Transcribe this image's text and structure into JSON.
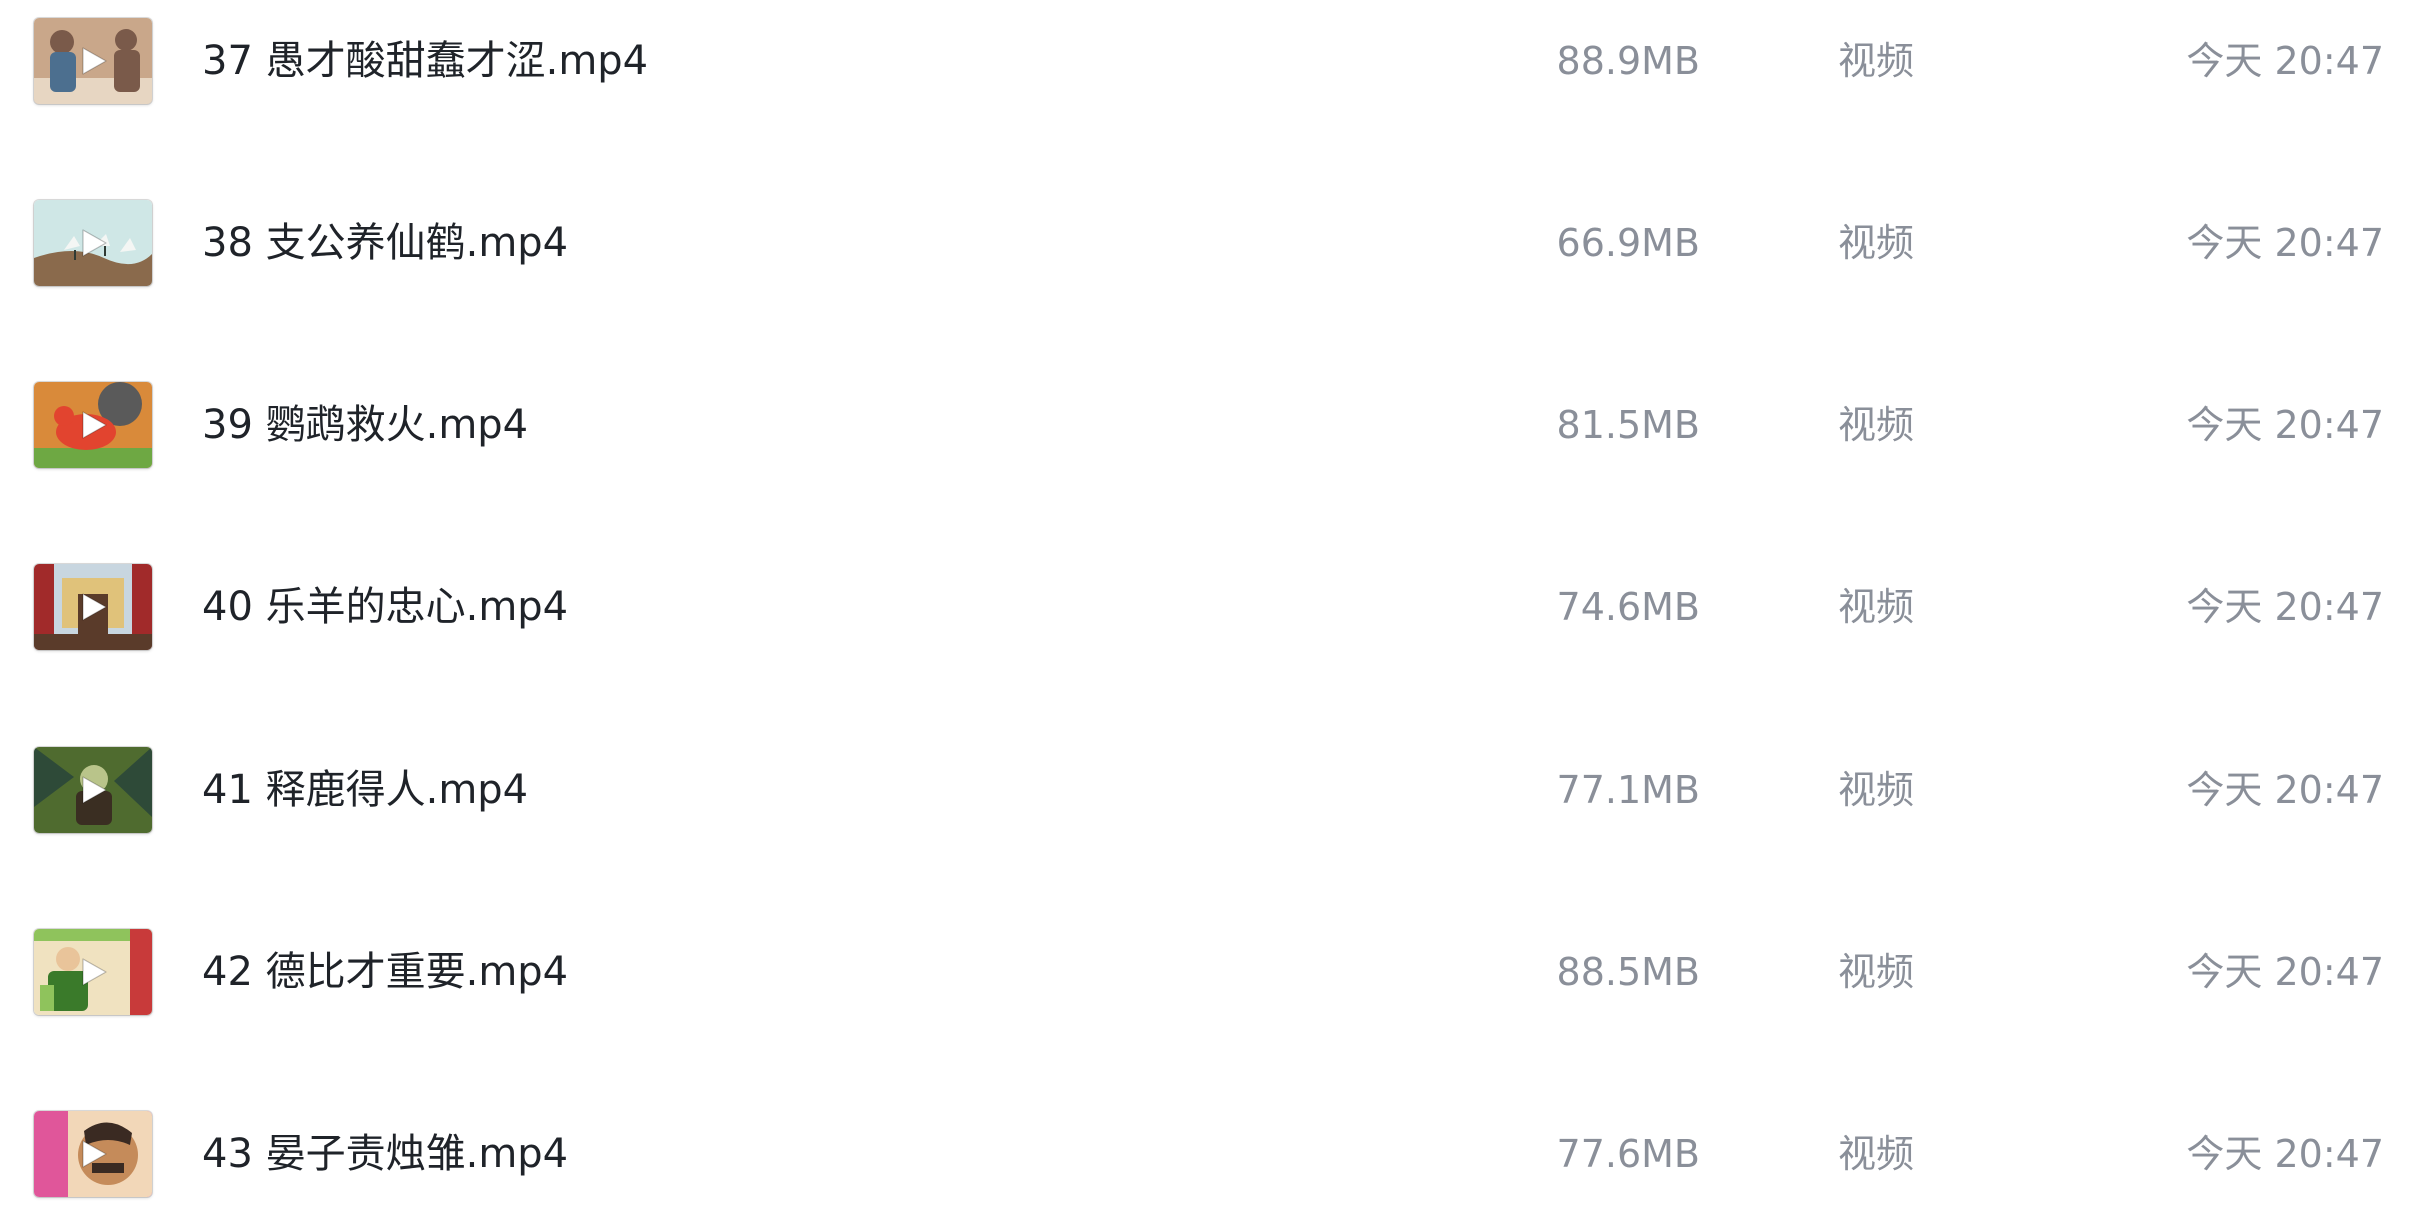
{
  "files": [
    {
      "name": "37 愚才酸甜蠢才涩.mp4",
      "size": "88.9MB",
      "type": "视频",
      "time": "今天 20:47",
      "thumb_icon": "video-thumbnail-icon",
      "palette": [
        "#c9a78a",
        "#7a5a4a",
        "#e7d6c2",
        "#4c6f8f"
      ]
    },
    {
      "name": "38 支公养仙鹤.mp4",
      "size": "66.9MB",
      "type": "视频",
      "time": "今天 20:47",
      "thumb_icon": "video-thumbnail-icon",
      "palette": [
        "#cfe7e6",
        "#8a6a4c",
        "#f4f6f4",
        "#2f3a34"
      ]
    },
    {
      "name": "39 鹦鹉救火.mp4",
      "size": "81.5MB",
      "type": "视频",
      "time": "今天 20:47",
      "thumb_icon": "video-thumbnail-icon",
      "palette": [
        "#d98a3a",
        "#5a5a5a",
        "#e2442f",
        "#6ea843"
      ]
    },
    {
      "name": "40 乐羊的忠心.mp4",
      "size": "74.6MB",
      "type": "视频",
      "time": "今天 20:47",
      "thumb_icon": "video-thumbnail-icon",
      "palette": [
        "#c8d6e0",
        "#a12a2a",
        "#5a3b2a",
        "#e0c27a"
      ]
    },
    {
      "name": "41 释鹿得人.mp4",
      "size": "77.1MB",
      "type": "视频",
      "time": "今天 20:47",
      "thumb_icon": "video-thumbnail-icon",
      "palette": [
        "#4f6b2f",
        "#3a2e22",
        "#b9c48a",
        "#2e4a38"
      ]
    },
    {
      "name": "42 德比才重要.mp4",
      "size": "88.5MB",
      "type": "视频",
      "time": "今天 20:47",
      "thumb_icon": "video-thumbnail-icon",
      "palette": [
        "#8fc35c",
        "#c83a3a",
        "#f0e2c0",
        "#3a7a2a"
      ]
    },
    {
      "name": "43 晏子责烛雏.mp4",
      "size": "77.6MB",
      "type": "视频",
      "time": "今天 20:47",
      "thumb_icon": "video-thumbnail-icon",
      "palette": [
        "#e0569a",
        "#c58b5a",
        "#3a2a22",
        "#f2d7b8"
      ]
    }
  ],
  "play_icon": "play-icon",
  "colors": {
    "filename": "#1f2329",
    "meta": "#8a8f99",
    "background": "#ffffff"
  }
}
